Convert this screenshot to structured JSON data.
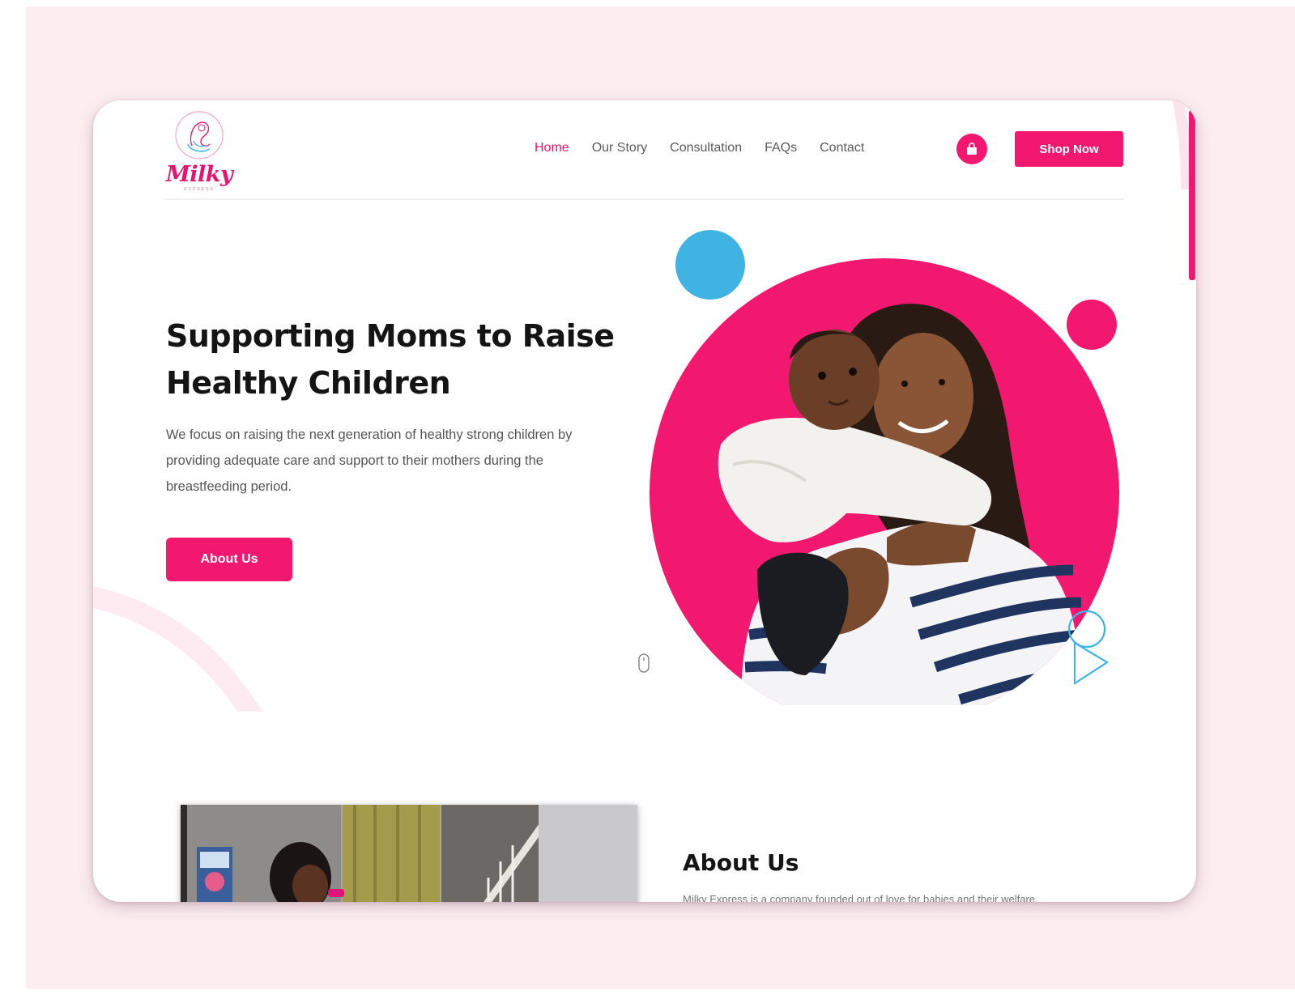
{
  "brand": {
    "name": "Milky",
    "tagline": "EXPRESS"
  },
  "nav": {
    "items": [
      "Home",
      "Our Story",
      "Consultation",
      "FAQs",
      "Contact"
    ],
    "active": "Home"
  },
  "header": {
    "cart_icon": "shopping-bag-icon",
    "shop_label": "Shop Now"
  },
  "hero": {
    "title": "Supporting Moms to Raise Healthy Children",
    "description": "We focus on raising the next generation of healthy strong children by providing adequate care and support to their mothers during the breastfeeding period.",
    "cta_label": "About Us",
    "scroll_icon": "mouse-scroll-icon"
  },
  "about": {
    "title": "About Us",
    "text": "Milky Express is a company founded out of love for babies and their welfare."
  },
  "colors": {
    "accent": "#f2186f",
    "accent_light": "#fde3ec",
    "blue": "#3fb4e3",
    "backdrop": "#fcedf1"
  }
}
